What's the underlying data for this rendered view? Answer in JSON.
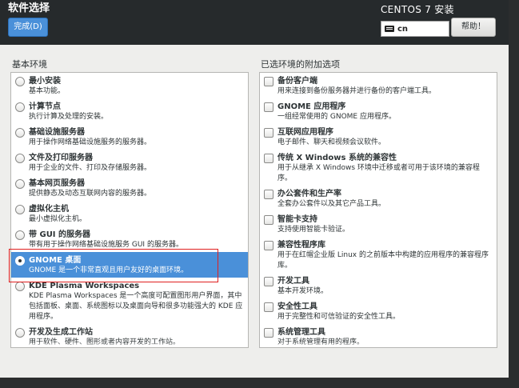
{
  "header": {
    "title": "软件选择",
    "done_label": "完成(D)",
    "product": "CENTOS 7 安装",
    "keyboard": "cn",
    "help_label": "帮助！"
  },
  "left": {
    "label": "基本环境",
    "items": [
      {
        "title": "最小安装",
        "desc": "基本功能。",
        "selected": false
      },
      {
        "title": "计算节点",
        "desc": "执行计算及处理的安装。",
        "selected": false
      },
      {
        "title": "基础设施服务器",
        "desc": "用于操作网络基础设施服务的服务器。",
        "selected": false
      },
      {
        "title": "文件及打印服务器",
        "desc": "用于企业的文件、打印及存储服务器。",
        "selected": false
      },
      {
        "title": "基本网页服务器",
        "desc": "提供静态及动态互联网内容的服务器。",
        "selected": false
      },
      {
        "title": "虚拟化主机",
        "desc": "最小虚拟化主机。",
        "selected": false
      },
      {
        "title": "带 GUI 的服务器",
        "desc": "带有用于操作网络基础设施服务 GUI 的服务器。",
        "selected": false
      },
      {
        "title": "GNOME 桌面",
        "desc": "GNOME 是一个非常直观且用户友好的桌面环境。",
        "selected": true
      },
      {
        "title": "KDE Plasma Workspaces",
        "desc": "KDE Plasma Workspaces 是一个高度可配置图形用户界面，其中包括面板、桌面、系统图标以及桌面向导和很多功能强大的 KDE 应用程序。",
        "selected": false
      },
      {
        "title": "开发及生成工作站",
        "desc": "用于软件、硬件、图形或者内容开发的工作站。",
        "selected": false
      }
    ]
  },
  "right": {
    "label": "已选环境的附加选项",
    "items": [
      {
        "title": "备份客户端",
        "desc": "用来连接到备份服务器并进行备份的客户端工具。"
      },
      {
        "title": "GNOME 应用程序",
        "desc": "一组经常使用的 GNOME 应用程序。"
      },
      {
        "title": "互联网应用程序",
        "desc": "电子邮件、聊天和视频会议软件。"
      },
      {
        "title": "传统 X Windows 系统的兼容性",
        "desc": "用于从继承 X Windows 环境中迁移或者可用于该环境的兼容程序。"
      },
      {
        "title": "办公套件和生产率",
        "desc": "全套办公套件以及其它产品工具。"
      },
      {
        "title": "智能卡支持",
        "desc": "支持使用智能卡验证。"
      },
      {
        "title": "兼容性程序库",
        "desc": "用于在红帽企业版 Linux 的之前版本中构建的应用程序的兼容程序库。"
      },
      {
        "title": "开发工具",
        "desc": "基本开发环境。"
      },
      {
        "title": "安全性工具",
        "desc": "用于完整性和可信验证的安全性工具。"
      },
      {
        "title": "系统管理工具",
        "desc": "对于系统管理有用的程序。"
      }
    ]
  },
  "colors": {
    "accent": "#4a90d9",
    "header_bg": "#262a2c",
    "highlight_outline": "#e02020"
  }
}
